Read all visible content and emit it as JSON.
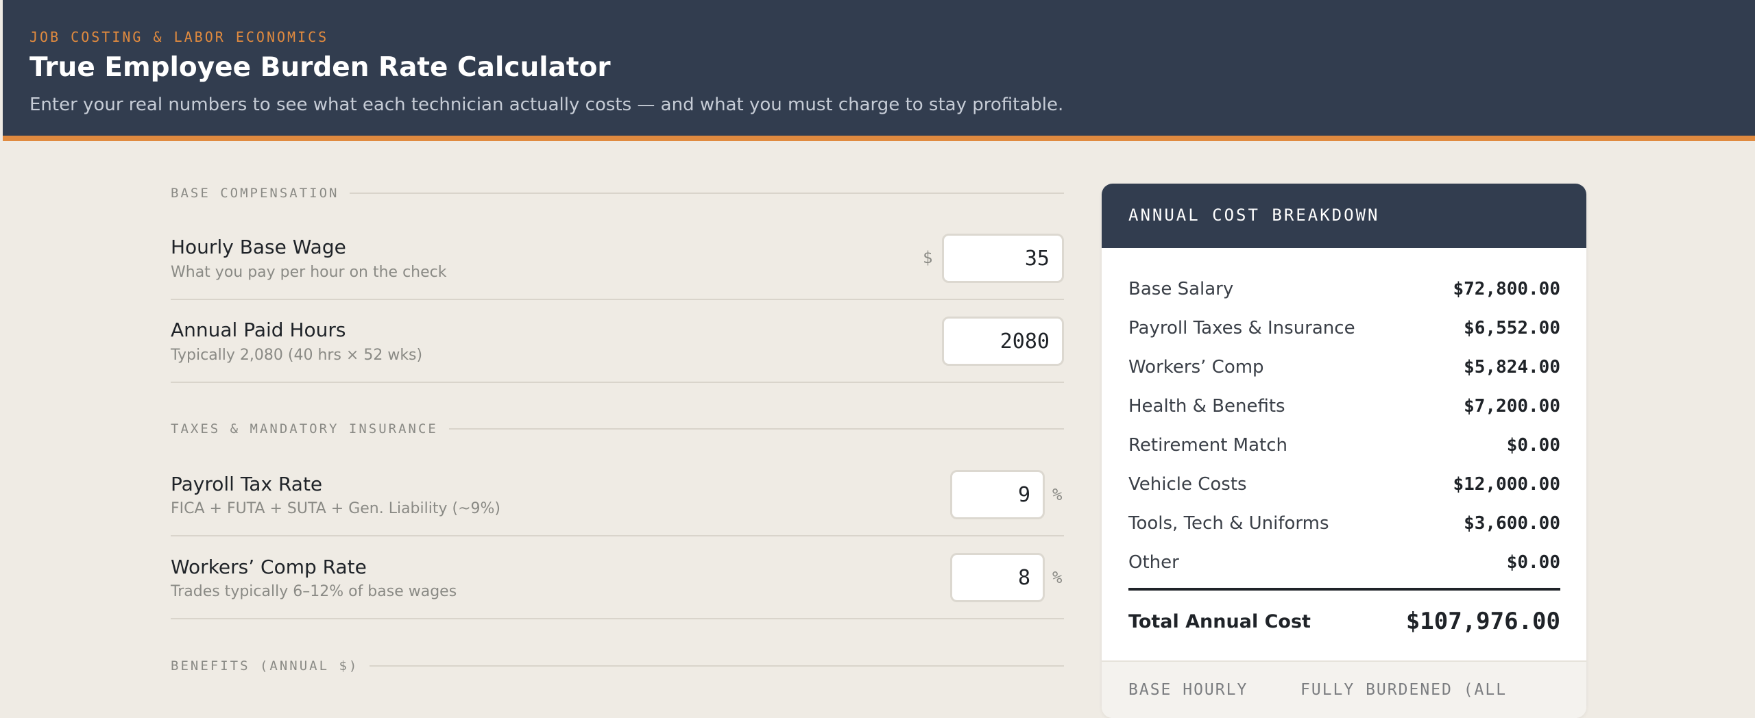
{
  "header": {
    "eyebrow": "JOB COSTING & LABOR ECONOMICS",
    "title": "True Employee Burden Rate Calculator",
    "subtitle": "Enter your real numbers to see what each technician actually costs — and what you must charge to stay profitable."
  },
  "sections": {
    "base_comp": "BASE COMPENSATION",
    "taxes": "TAXES & MANDATORY INSURANCE",
    "benefits": "BENEFITS (ANNUAL $)"
  },
  "fields": {
    "hourly_wage": {
      "label": "Hourly Base Wage",
      "hint": "What you pay per hour on the check",
      "prefix": "$",
      "value": "35"
    },
    "annual_hours": {
      "label": "Annual Paid Hours",
      "hint": "Typically 2,080 (40 hrs × 52 wks)",
      "value": "2080"
    },
    "payroll_tax": {
      "label": "Payroll Tax Rate",
      "hint": "FICA + FUTA + SUTA + Gen. Liability (~9%)",
      "value": "9",
      "suffix": "%"
    },
    "workers_comp": {
      "label": "Workers’ Comp Rate",
      "hint": "Trades typically 6–12% of base wages",
      "value": "8",
      "suffix": "%"
    }
  },
  "breakdown": {
    "title": "ANNUAL COST BREAKDOWN",
    "items": [
      {
        "name": "Base Salary",
        "amount": "$72,800.00"
      },
      {
        "name": "Payroll Taxes & Insurance",
        "amount": "$6,552.00"
      },
      {
        "name": "Workers’ Comp",
        "amount": "$5,824.00"
      },
      {
        "name": "Health & Benefits",
        "amount": "$7,200.00"
      },
      {
        "name": "Retirement Match",
        "amount": "$0.00"
      },
      {
        "name": "Vehicle Costs",
        "amount": "$12,000.00"
      },
      {
        "name": "Tools, Tech & Uniforms",
        "amount": "$3,600.00"
      },
      {
        "name": "Other",
        "amount": "$0.00"
      }
    ],
    "total_label": "Total Annual Cost",
    "total_amount": "$107,976.00",
    "footer_left": "BASE HOURLY",
    "footer_right": "FULLY BURDENED (ALL"
  },
  "colors": {
    "header_bg": "#323d4f",
    "accent": "#e08a3f",
    "page_bg": "#efebe4"
  }
}
